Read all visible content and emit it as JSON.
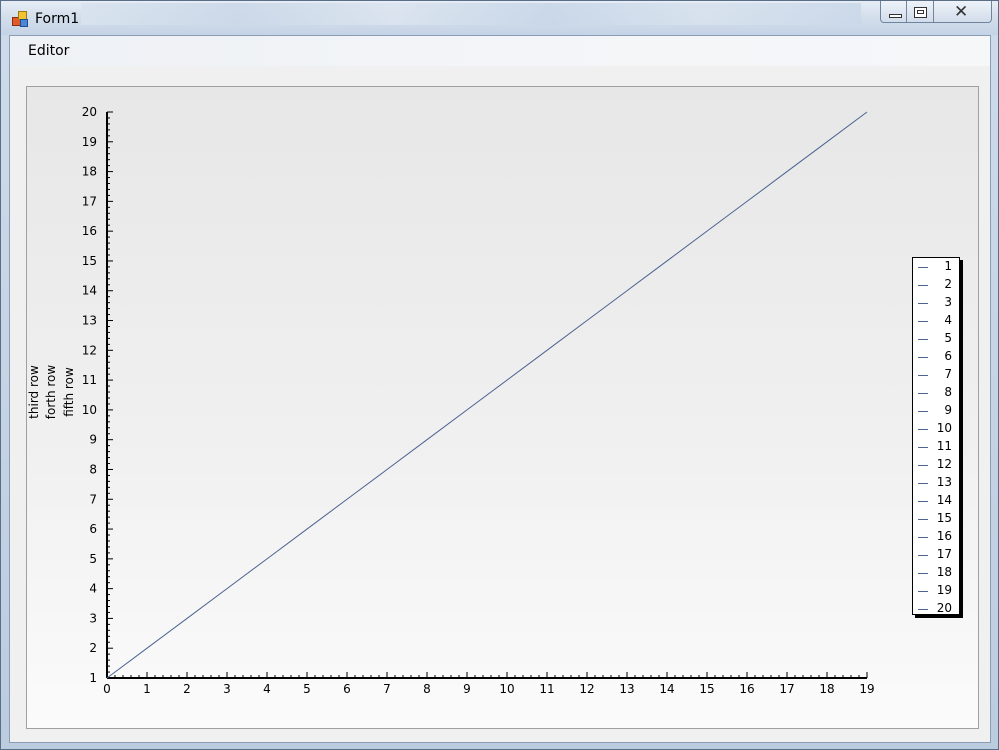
{
  "window": {
    "title": "Form1"
  },
  "menu": {
    "items": [
      {
        "label": "Editor"
      }
    ]
  },
  "chart_data": {
    "type": "line",
    "title": "",
    "xlabel": "",
    "ylabel_lines": [
      "third row",
      "forth row",
      "fifth row"
    ],
    "xlim": [
      0,
      19
    ],
    "ylim": [
      1,
      20
    ],
    "x_ticks": [
      0,
      1,
      2,
      3,
      4,
      5,
      6,
      7,
      8,
      9,
      10,
      11,
      12,
      13,
      14,
      15,
      16,
      17,
      18,
      19
    ],
    "y_ticks": [
      1,
      2,
      3,
      4,
      5,
      6,
      7,
      8,
      9,
      10,
      11,
      12,
      13,
      14,
      15,
      16,
      17,
      18,
      19,
      20
    ],
    "x": [
      0,
      1,
      2,
      3,
      4,
      5,
      6,
      7,
      8,
      9,
      10,
      11,
      12,
      13,
      14,
      15,
      16,
      17,
      18,
      19
    ],
    "series": [
      {
        "values": [
          1,
          2,
          3,
          4,
          5,
          6,
          7,
          8,
          9,
          10,
          11,
          12,
          13,
          14,
          15,
          16,
          17,
          18,
          19,
          20
        ],
        "color": "#4a6390"
      }
    ],
    "legend_position": "right",
    "legend_entries": [
      "1",
      "2",
      "3",
      "4",
      "5",
      "6",
      "7",
      "8",
      "9",
      "10",
      "11",
      "12",
      "13",
      "14",
      "15",
      "16",
      "17",
      "18",
      "19",
      "20"
    ],
    "grid": false
  }
}
